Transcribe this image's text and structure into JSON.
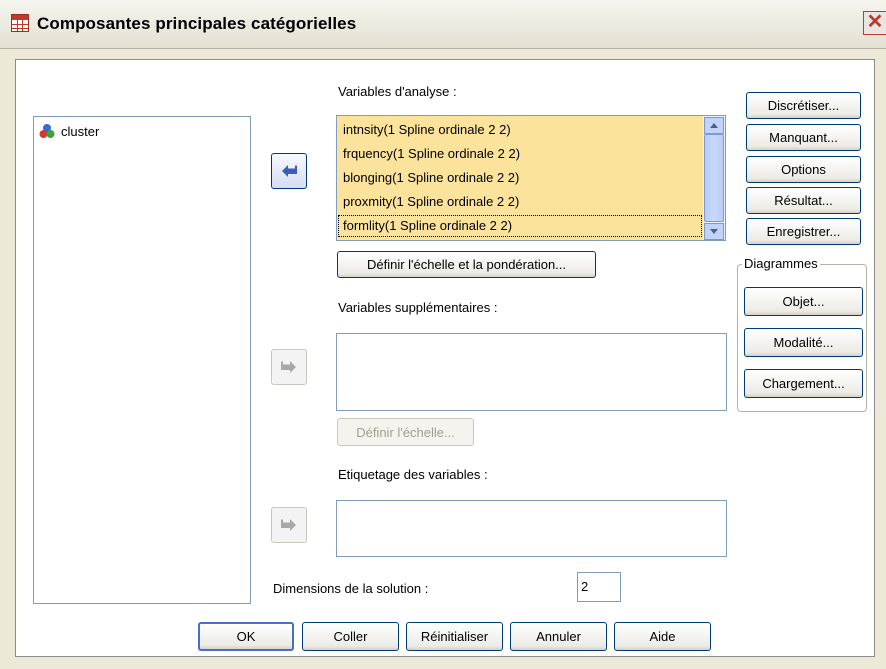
{
  "window": {
    "title": "Composantes principales catégorielles",
    "close_glyph": "✕"
  },
  "source_list": {
    "items": [
      {
        "label": "cluster",
        "icon": "nominal-variable-icon"
      }
    ]
  },
  "analysis": {
    "label": "Variables d'analyse :",
    "items": [
      "intnsity(1 Spline ordinale 2 2)",
      "frquency(1 Spline ordinale 2 2)",
      "blonging(1 Spline ordinale 2 2)",
      "proxmity(1 Spline ordinale 2 2)",
      "formlity(1 Spline ordinale 2 2)"
    ],
    "selected_index": 4,
    "define_scale_weight": "Définir l'échelle et la pondération..."
  },
  "supplementary": {
    "label": "Variables supplémentaires :",
    "define_scale": "Définir l'échelle..."
  },
  "labeling": {
    "label": "Etiquetage des variables :"
  },
  "dimensions": {
    "label": "Dimensions de la solution :",
    "value": "2"
  },
  "side_buttons": {
    "discretize": "Discrétiser...",
    "missing": "Manquant...",
    "options": "Options",
    "output": "Résultat...",
    "save": "Enregistrer..."
  },
  "plots": {
    "legend": "Diagrammes",
    "object": "Objet...",
    "category": "Modalité...",
    "loading": "Chargement..."
  },
  "footer": {
    "ok": "OK",
    "paste": "Coller",
    "reset": "Réinitialiser",
    "cancel": "Annuler",
    "help": "Aide"
  },
  "colors": {
    "selection": "#fbe39b",
    "panel": "#ffffff",
    "frame": "#ece9d8",
    "arrow_active": "#3d5fb3",
    "arrow_disabled": "#a8a8a8"
  }
}
